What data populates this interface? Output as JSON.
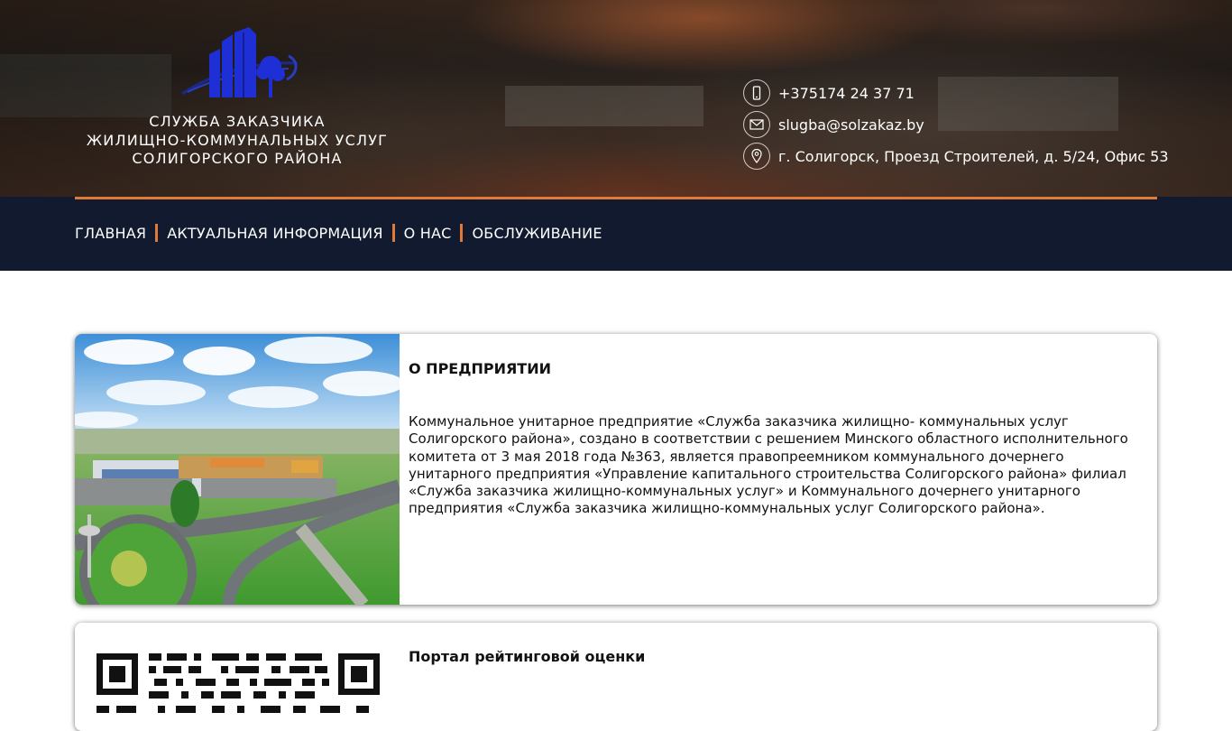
{
  "brand": {
    "line1": "СЛУЖБА ЗАКАЗЧИКА",
    "line2": "ЖИЛИЩНО-КОММУНАЛЬНЫХ УСЛУГ",
    "line3": "СОЛИГОРСКОГО РАЙОНА",
    "logo_color": "#1f2fd6"
  },
  "contacts": {
    "phone": "+375174 24 37 71",
    "email": "slugba@solzakaz.by",
    "address": "г. Солигорск, Проезд Строителей, д. 5/24, Офис 53"
  },
  "nav": {
    "items": [
      {
        "label": "ГЛАВНАЯ"
      },
      {
        "label": "АКТУАЛЬНАЯ ИНФОРМАЦИЯ"
      },
      {
        "label": "О НАС"
      },
      {
        "label": "ОБСЛУЖИВАНИЕ"
      }
    ],
    "accent": "#e07a38",
    "background": "#111a2e"
  },
  "cards": [
    {
      "title": "О ПРЕДПРИЯТИИ",
      "text": "Коммунальное унитарное предприятие «Служба заказчика жилищно- коммунальных услуг Солигорского района», создано в соответствии с решением Минского областного исполнительного комитета от 3 мая 2018 года №363, является правопреемником коммунального дочернего унитарного предприятия «Управление капитального строительства Солигорского района» филиал «Служба заказчика жилищно-коммунальных услуг» и Коммунального дочернего унитарного предприятия «Служба заказчика жилищно-коммунальных услуг Солигорского района»."
    },
    {
      "title": "Портал рейтинговой оценки"
    }
  ]
}
